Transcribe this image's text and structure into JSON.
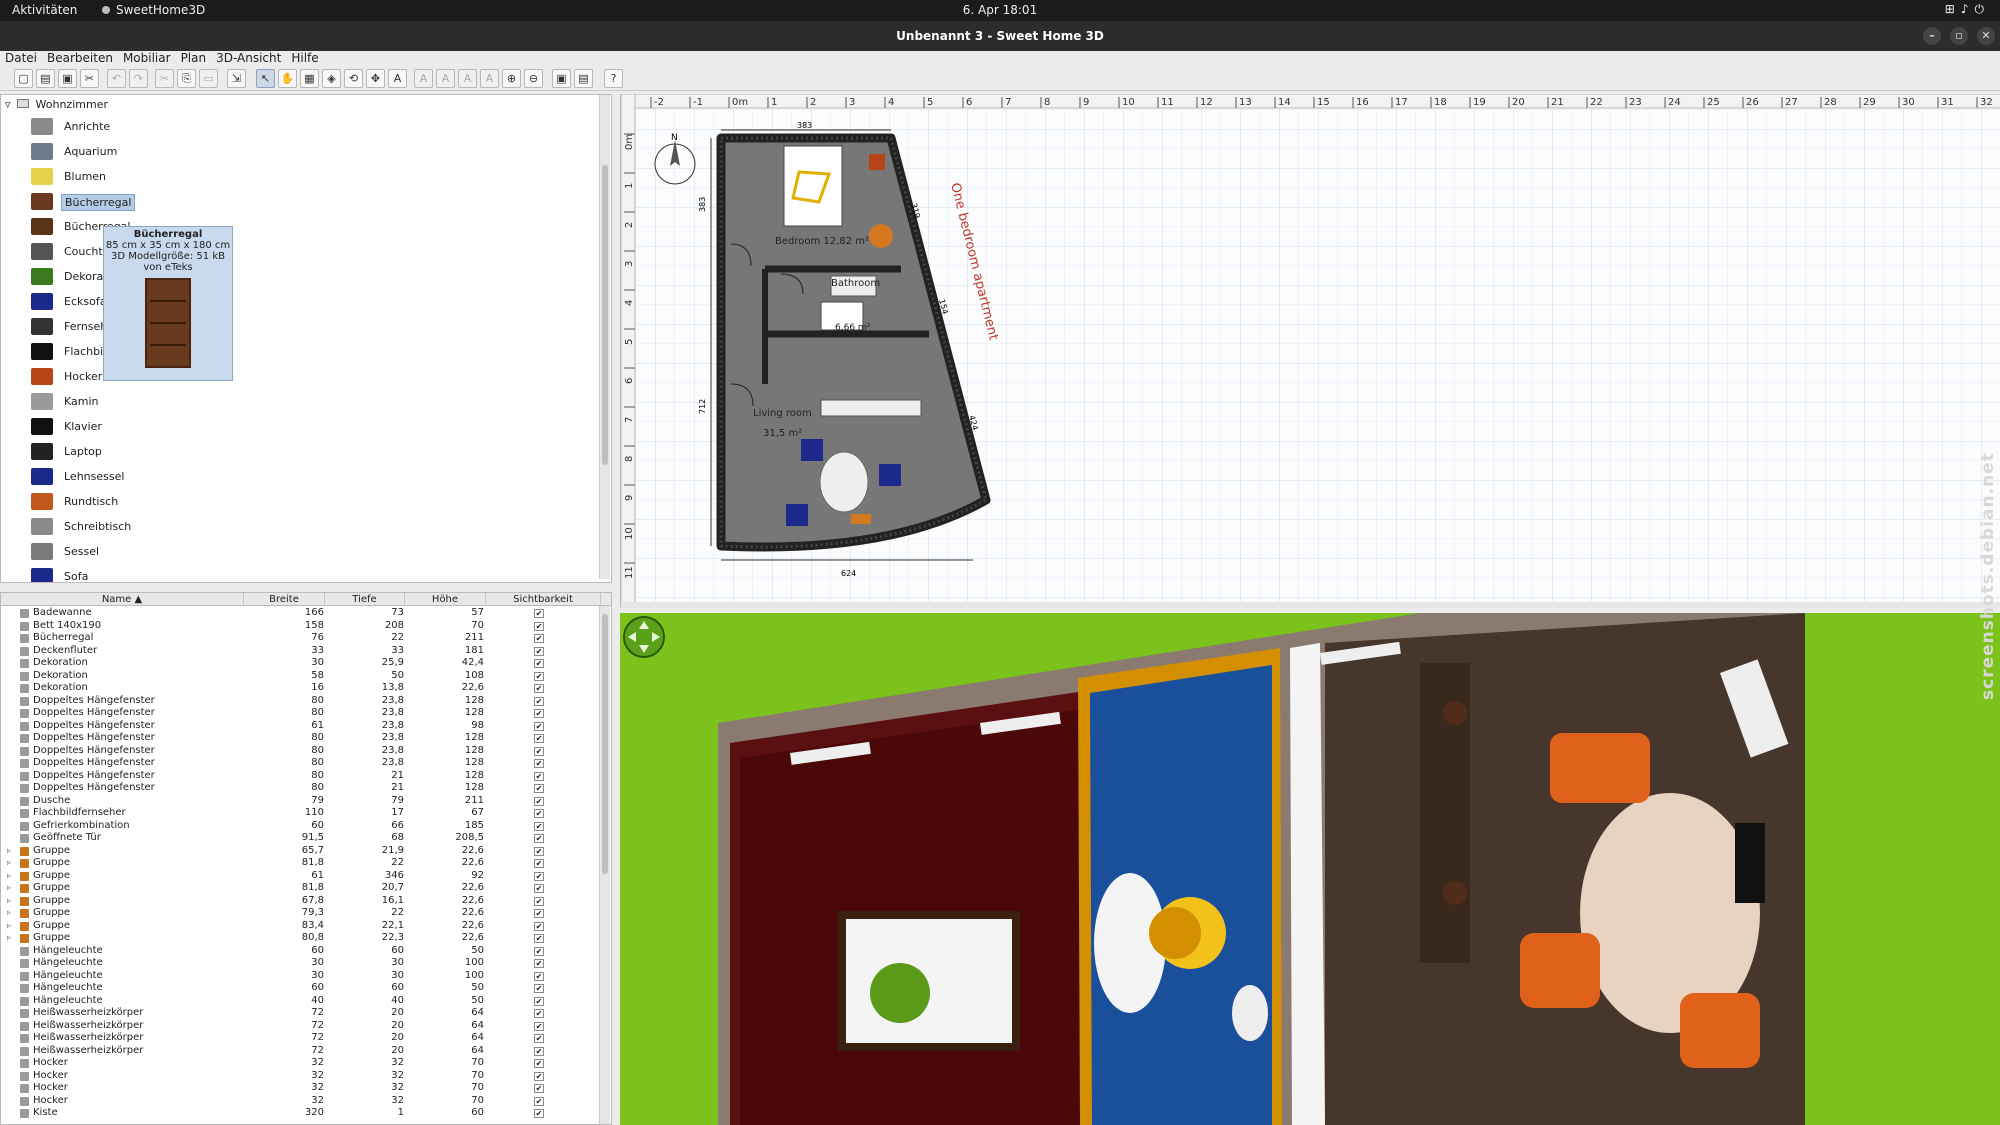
{
  "system_bar": {
    "activities": "Aktivitäten",
    "app_name": "SweetHome3D",
    "clock": "6. Apr  18:01"
  },
  "window": {
    "title": "Unbenannt 3 - Sweet Home 3D"
  },
  "menu": [
    "Datei",
    "Bearbeiten",
    "Mobiliar",
    "Plan",
    "3D-Ansicht",
    "Hilfe"
  ],
  "catalog": {
    "root": "Wohnzimmer",
    "items": [
      {
        "label": "Anrichte",
        "color": "#8a8a8a"
      },
      {
        "label": "Aquarium",
        "color": "#6c7a8a"
      },
      {
        "label": "Blumen",
        "color": "#e4d34a"
      },
      {
        "label": "Bücherregal",
        "color": "#6a3a1e"
      },
      {
        "label": "Bücherregal",
        "color": "#5a3318"
      },
      {
        "label": "Couchtisch",
        "color": "#555555"
      },
      {
        "label": "Dekoration",
        "color": "#3b7a1e"
      },
      {
        "label": "Ecksofa",
        "color": "#1b2a8a"
      },
      {
        "label": "Fernseher",
        "color": "#333333"
      },
      {
        "label": "Flachbildfernseher",
        "color": "#111111"
      },
      {
        "label": "Hocker",
        "color": "#b8441a"
      },
      {
        "label": "Kamin",
        "color": "#9a9a9a"
      },
      {
        "label": "Klavier",
        "color": "#111111"
      },
      {
        "label": "Laptop",
        "color": "#222222"
      },
      {
        "label": "Lehnsessel",
        "color": "#1b2a8a"
      },
      {
        "label": "Rundtisch",
        "color": "#c2581c"
      },
      {
        "label": "Schreibtisch",
        "color": "#8a8a8a"
      },
      {
        "label": "Sessel",
        "color": "#7a7a7a"
      },
      {
        "label": "Sofa",
        "color": "#1b2a8a"
      }
    ],
    "tooltip": {
      "name": "Bücherregal",
      "size": "85 cm x 35 cm x 180 cm",
      "model": "3D Modellgröße: 51 kB",
      "author": "von eTeks"
    }
  },
  "furniture_table": {
    "headers": {
      "name": "Name ▲",
      "width": "Breite",
      "depth": "Tiefe",
      "height": "Höhe",
      "visible": "Sichtbarkeit"
    },
    "rows": [
      {
        "name": "Badewanne",
        "w": "166",
        "d": "73",
        "h": "57",
        "group": false
      },
      {
        "name": "Bett 140x190",
        "w": "158",
        "d": "208",
        "h": "70",
        "group": false
      },
      {
        "name": "Bücherregal",
        "w": "76",
        "d": "22",
        "h": "211",
        "group": false
      },
      {
        "name": "Deckenfluter",
        "w": "33",
        "d": "33",
        "h": "181",
        "group": false
      },
      {
        "name": "Dekoration",
        "w": "30",
        "d": "25,9",
        "h": "42,4",
        "group": false
      },
      {
        "name": "Dekoration",
        "w": "58",
        "d": "50",
        "h": "108",
        "group": false
      },
      {
        "name": "Dekoration",
        "w": "16",
        "d": "13,8",
        "h": "22,6",
        "group": false
      },
      {
        "name": "Doppeltes Hängefenster",
        "w": "80",
        "d": "23,8",
        "h": "128",
        "group": false
      },
      {
        "name": "Doppeltes Hängefenster",
        "w": "80",
        "d": "23,8",
        "h": "128",
        "group": false
      },
      {
        "name": "Doppeltes Hängefenster",
        "w": "61",
        "d": "23,8",
        "h": "98",
        "group": false
      },
      {
        "name": "Doppeltes Hängefenster",
        "w": "80",
        "d": "23,8",
        "h": "128",
        "group": false
      },
      {
        "name": "Doppeltes Hängefenster",
        "w": "80",
        "d": "23,8",
        "h": "128",
        "group": false
      },
      {
        "name": "Doppeltes Hängefenster",
        "w": "80",
        "d": "23,8",
        "h": "128",
        "group": false
      },
      {
        "name": "Doppeltes Hängefenster",
        "w": "80",
        "d": "21",
        "h": "128",
        "group": false
      },
      {
        "name": "Doppeltes Hängefenster",
        "w": "80",
        "d": "21",
        "h": "128",
        "group": false
      },
      {
        "name": "Dusche",
        "w": "79",
        "d": "79",
        "h": "211",
        "group": false
      },
      {
        "name": "Flachbildfernseher",
        "w": "110",
        "d": "17",
        "h": "67",
        "group": false
      },
      {
        "name": "Gefrierkombination",
        "w": "60",
        "d": "66",
        "h": "185",
        "group": false
      },
      {
        "name": "Geöffnete Tür",
        "w": "91,5",
        "d": "68",
        "h": "208,5",
        "group": false
      },
      {
        "name": "Gruppe",
        "w": "65,7",
        "d": "21,9",
        "h": "22,6",
        "group": true
      },
      {
        "name": "Gruppe",
        "w": "81,8",
        "d": "22",
        "h": "22,6",
        "group": true
      },
      {
        "name": "Gruppe",
        "w": "61",
        "d": "346",
        "h": "92",
        "group": true
      },
      {
        "name": "Gruppe",
        "w": "81,8",
        "d": "20,7",
        "h": "22,6",
        "group": true
      },
      {
        "name": "Gruppe",
        "w": "67,8",
        "d": "16,1",
        "h": "22,6",
        "group": true
      },
      {
        "name": "Gruppe",
        "w": "79,3",
        "d": "22",
        "h": "22,6",
        "group": true
      },
      {
        "name": "Gruppe",
        "w": "83,4",
        "d": "22,1",
        "h": "22,6",
        "group": true
      },
      {
        "name": "Gruppe",
        "w": "80,8",
        "d": "22,3",
        "h": "22,6",
        "group": true
      },
      {
        "name": "Hängeleuchte",
        "w": "60",
        "d": "60",
        "h": "50",
        "group": false
      },
      {
        "name": "Hängeleuchte",
        "w": "30",
        "d": "30",
        "h": "100",
        "group": false
      },
      {
        "name": "Hängeleuchte",
        "w": "30",
        "d": "30",
        "h": "100",
        "group": false
      },
      {
        "name": "Hängeleuchte",
        "w": "60",
        "d": "60",
        "h": "50",
        "group": false
      },
      {
        "name": "Hängeleuchte",
        "w": "40",
        "d": "40",
        "h": "50",
        "group": false
      },
      {
        "name": "Heißwasserheizkörper",
        "w": "72",
        "d": "20",
        "h": "64",
        "group": false
      },
      {
        "name": "Heißwasserheizkörper",
        "w": "72",
        "d": "20",
        "h": "64",
        "group": false
      },
      {
        "name": "Heißwasserheizkörper",
        "w": "72",
        "d": "20",
        "h": "64",
        "group": false
      },
      {
        "name": "Heißwasserheizkörper",
        "w": "72",
        "d": "20",
        "h": "64",
        "group": false
      },
      {
        "name": "Hocker",
        "w": "32",
        "d": "32",
        "h": "70",
        "group": false
      },
      {
        "name": "Hocker",
        "w": "32",
        "d": "32",
        "h": "70",
        "group": false
      },
      {
        "name": "Hocker",
        "w": "32",
        "d": "32",
        "h": "70",
        "group": false
      },
      {
        "name": "Hocker",
        "w": "32",
        "d": "32",
        "h": "70",
        "group": false
      },
      {
        "name": "Kiste",
        "w": "320",
        "d": "1",
        "h": "60",
        "group": false
      }
    ]
  },
  "plan": {
    "ruler_x": [
      "-2",
      "-1",
      "0m",
      "1",
      "2",
      "3",
      "4",
      "5",
      "6",
      "7",
      "8",
      "9",
      "10",
      "11",
      "12",
      "13",
      "14",
      "15",
      "16",
      "17",
      "18",
      "19",
      "20",
      "21",
      "22",
      "23",
      "24",
      "25",
      "26",
      "27",
      "28",
      "29",
      "30",
      "31",
      "32"
    ],
    "ruler_y": [
      "0m",
      "1",
      "2",
      "3",
      "4",
      "5",
      "6",
      "7",
      "8",
      "9",
      "10",
      "11"
    ],
    "rooms": [
      {
        "name": "Bedroom",
        "area": "12,82 m²"
      },
      {
        "name": "Bathroom",
        "area": "6,66 m²"
      },
      {
        "name": "Living room",
        "area": "31,5 m²"
      }
    ],
    "dimensions": [
      "383",
      "383",
      "712",
      "624",
      "319",
      "154",
      "424"
    ],
    "label": "One bedroom apartment"
  },
  "watermark": "screenshots.debian.net",
  "colors": {
    "accent_label": "#c0392b",
    "grass": "#7bc21a",
    "floor_dark": "#3a2a1e"
  }
}
